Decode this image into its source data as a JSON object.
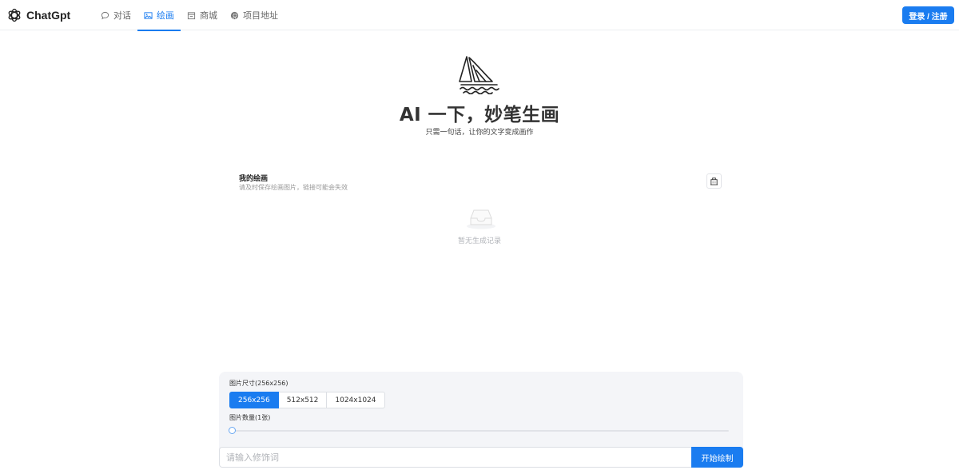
{
  "header": {
    "brand": "ChatGpt",
    "nav": [
      {
        "label": "对话",
        "icon": "chat-bubble-icon",
        "active": false
      },
      {
        "label": "绘画",
        "icon": "picture-icon",
        "active": true
      },
      {
        "label": "商城",
        "icon": "shop-icon",
        "active": false
      },
      {
        "label": "项目地址",
        "icon": "github-icon",
        "active": false
      }
    ],
    "login_label": "登录 / 注册"
  },
  "hero": {
    "title": "AI 一下，妙笔生画",
    "subtitle": "只需一句话，让你的文字变成画作"
  },
  "gallery": {
    "title": "我的绘画",
    "subtitle": "请及时保存绘画图片，链接可能会失效",
    "empty_text": "暂无生成记录"
  },
  "controls": {
    "size_label": "图片尺寸(256x256)",
    "sizes": [
      "256x256",
      "512x512",
      "1024x1024"
    ],
    "selected_size": "256x256",
    "count_label": "图片数量(1张)",
    "count_value": 1,
    "prompt_placeholder": "请输入修饰词",
    "start_label": "开始绘制"
  },
  "colors": {
    "accent": "#1a7cf0",
    "panel_bg": "#f4f5f8"
  }
}
